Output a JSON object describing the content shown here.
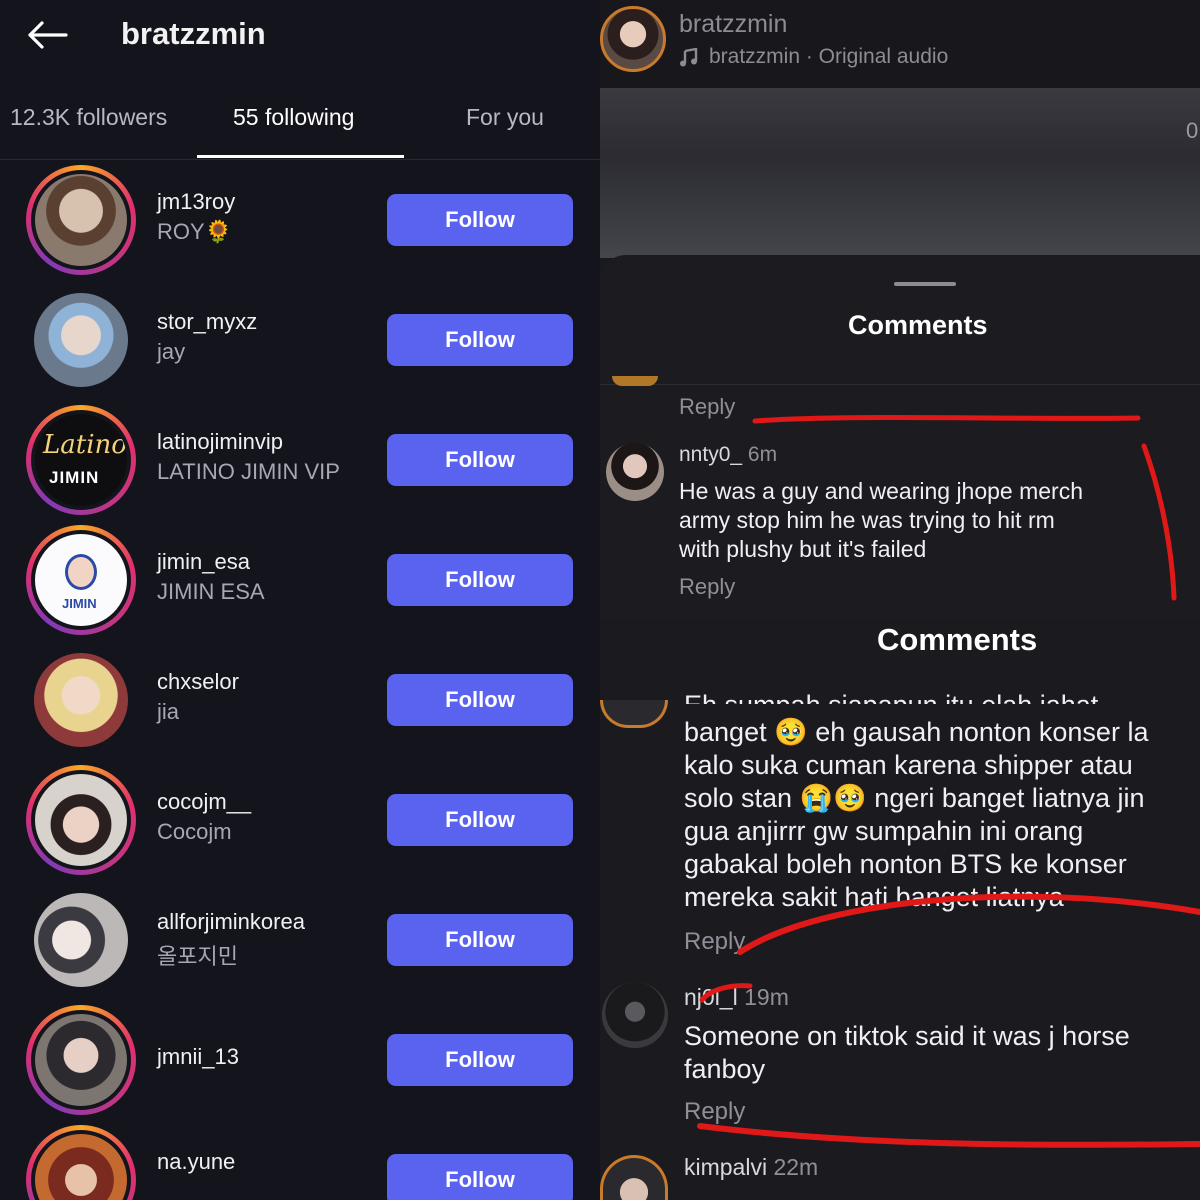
{
  "left": {
    "username": "bratzzmin",
    "tabs": [
      {
        "label": "12.3K followers"
      },
      {
        "label": "55 following"
      },
      {
        "label": "For you"
      }
    ],
    "following": [
      {
        "username": "jm13roy",
        "subtitle": "ROY🌻",
        "button": "Follow"
      },
      {
        "username": "stor_myxz",
        "subtitle": "jay",
        "button": "Follow"
      },
      {
        "username": "latinojiminvip",
        "subtitle": "LATINO JIMIN VIP",
        "button": "Follow"
      },
      {
        "username": "jimin_esa",
        "subtitle": "JIMIN ESA",
        "button": "Follow"
      },
      {
        "username": "chxselor",
        "subtitle": "jia",
        "button": "Follow"
      },
      {
        "username": "cocojm__",
        "subtitle": "Cocojm",
        "button": "Follow"
      },
      {
        "username": "allforjiminkorea",
        "subtitle": "올포지민",
        "button": "Follow"
      },
      {
        "username": "jmnii_13",
        "subtitle": "",
        "button": "Follow"
      },
      {
        "username": "na.yune",
        "subtitle": "",
        "button": "Follow"
      }
    ],
    "avatar_texts": {
      "latino_script": "Latino",
      "latino_word": "JIMIN",
      "esa_word": "JIMIN"
    }
  },
  "right": {
    "reel": {
      "username": "bratzzmin",
      "audio": "bratzzmin · Original audio",
      "counter": "0"
    },
    "comments_title_1": "Comments",
    "reply_label": "Reply",
    "comment_1": {
      "handle": "nnty0_",
      "time": "6m",
      "lines": [
        "He was a guy and wearing jhope merch",
        "army stop him he was trying to hit rm",
        "with plushy but it's failed"
      ],
      "reply": "Reply"
    },
    "comments_title_2": "Comments",
    "comment_2": {
      "cutoff_line": "Eh sumpah siapapun itu elah jahat",
      "lines": [
        "banget 🥹 eh gausah nonton konser la",
        "kalo suka cuman karena shipper atau",
        "solo stan 😭🥹 ngeri banget liatnya jin",
        "gua anjirrr gw sumpahin ini orang",
        "gabakal boleh nonton BTS ke konser",
        "mereka sakit hati banget liatnya"
      ],
      "reply": "Reply"
    },
    "comment_3": {
      "handle": "nj0l_l",
      "time": "19m",
      "lines": [
        "Someone on tiktok said it was j horse",
        "fanboy"
      ],
      "reply": "Reply"
    },
    "comment_4": {
      "handle": "kimpalvi",
      "time": "22m"
    }
  },
  "colors": {
    "follow_button": "#5a62f0",
    "annotation_red": "#e01818",
    "background": "#14141c"
  },
  "icons": [
    "back-arrow-icon",
    "music-note-icon"
  ]
}
